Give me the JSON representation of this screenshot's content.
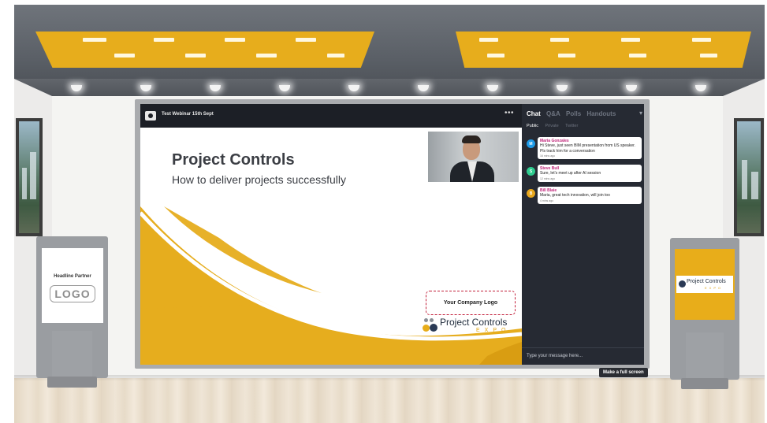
{
  "webinar": {
    "title": "Test Webinar 15th Sept",
    "more_label": "•••"
  },
  "slide": {
    "title": "Project Controls",
    "subtitle": "How to deliver projects successfully",
    "company_logo_placeholder": "Your Company Logo",
    "brand_name": "Project Controls",
    "brand_tagline": "EXPO"
  },
  "chat": {
    "tabs": [
      "Chat",
      "Q&A",
      "Polls",
      "Handouts"
    ],
    "active_tab": "Chat",
    "subtabs": [
      "Public",
      "Private",
      "Twitter"
    ],
    "active_subtab": "Public",
    "messages": [
      {
        "initial": "M",
        "avatar_color": "#1e9be8",
        "name": "Maria Gonzales",
        "text": "Hi Steve, just seen BIM presentation from US speaker. Pls track him for a conversation",
        "time": "16 mins ago"
      },
      {
        "initial": "S",
        "avatar_color": "#2ecc8f",
        "name": "Steve Bull",
        "text": "Sure, let's meet up after AI session",
        "time": "12 mins ago"
      },
      {
        "initial": "B",
        "avatar_color": "#e8a71c",
        "name": "Bill Blaie",
        "text": "Maria, great tech innovation, will join too",
        "time": "4 mins ago"
      }
    ],
    "input_placeholder": "Type your message here..."
  },
  "tooltip": "Make a full screen",
  "kiosk_left": {
    "label": "Headline Partner",
    "logo": "LOGO"
  },
  "kiosk_right": {
    "brand_name": "Project Controls",
    "brand_tagline": "EXPO"
  },
  "colors": {
    "brand_yellow": "#e8ad1a",
    "chat_bg": "#262a33",
    "name_magenta": "#c0267a"
  }
}
